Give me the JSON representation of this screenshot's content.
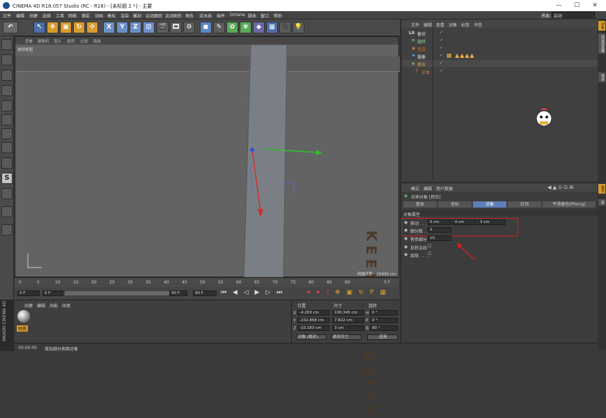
{
  "window": {
    "title": "CINEMA 4D R18.057 Studio (RC - R18) - [未标题 2 *] - 主要",
    "min": "—",
    "max": "☐",
    "close": "✕"
  },
  "menu": [
    "文件",
    "编辑",
    "创建",
    "选择",
    "工具",
    "网格",
    "捕捉",
    "动画",
    "模拟",
    "渲染",
    "雕刻",
    "运动跟踪",
    "运动图形",
    "角色",
    "流水线",
    "插件",
    "Octane",
    "脚本",
    "窗口",
    "帮助"
  ],
  "interface_label": "界面:",
  "interface_value": "启动",
  "viewport": {
    "menu": [
      "查看",
      "摄像机",
      "显示",
      "选项",
      "过滤",
      "面板"
    ],
    "view_name": "透视视图",
    "grid_label": "网格间距 : 10000 cm",
    "text": "KEEP CURIOSITY"
  },
  "object_manager": {
    "menu": [
      "文件",
      "编辑",
      "查看",
      "对象",
      "标签",
      "书签"
    ],
    "items": [
      {
        "name": "备份",
        "color": "#e0e0e0"
      },
      {
        "name": "旋转",
        "color": "#9fd89f"
      },
      {
        "name": "空白",
        "color": "#e07a3a"
      },
      {
        "name": "摄像",
        "color": "#e0e0e0"
      },
      {
        "name": "挤压",
        "color": "#e8b04a"
      },
      {
        "name": "文本",
        "color": "#e07a3a"
      }
    ]
  },
  "attributes": {
    "menu": [
      "模式",
      "编辑",
      "用户数据"
    ],
    "object_title": "拉伸对象 [挤压]",
    "tabs": [
      "基本",
      "坐标",
      "对象",
      "封顶",
      "平滑着色(Phong)"
    ],
    "active_tab": "对象",
    "section": "对象属性",
    "move_label": "移动 . . . .",
    "move_values": [
      "0 cm",
      "0 cm",
      "3 cm"
    ],
    "subdiv_label": "细分数 . .",
    "subdiv_value": "2",
    "iso_label": "等参细分",
    "iso_value": "10",
    "flip_label": "反转法线",
    "hier_label": "层级 . . . ."
  },
  "timeline": {
    "ticks": [
      "0",
      "5",
      "10",
      "15",
      "20",
      "25",
      "30",
      "35",
      "40",
      "45",
      "50",
      "55",
      "60",
      "65",
      "70",
      "75",
      "80",
      "85",
      "90"
    ],
    "frame_end": "0 F",
    "current": "0 F",
    "min_f": "0 F",
    "max_f": "90 F",
    "max_f2": "90 F"
  },
  "materials": {
    "menu": [
      "创建",
      "编辑",
      "功能",
      "纹理"
    ],
    "mat_name": "材质"
  },
  "coords": {
    "headers": [
      "位置",
      "尺寸",
      "旋转"
    ],
    "rows": [
      {
        "axis": "X",
        "pos": "-4.263 cm",
        "size": "100.345 cm",
        "rlabel": "H",
        "rot": "0 °"
      },
      {
        "axis": "Y",
        "pos": "-232.858 cm",
        "size": "7.822 cm",
        "rlabel": "P",
        "rot": "0 °"
      },
      {
        "axis": "Z",
        "pos": "-10.183 cm",
        "size": "3 cm",
        "rlabel": "B",
        "rot": "90 °"
      }
    ],
    "mode": "对象 (相对)",
    "size_mode": "绝对尺寸",
    "apply": "应用"
  },
  "status": {
    "time": "00:00:00",
    "msg": "增加细分表面对象"
  },
  "side_tabs": [
    "对象",
    "内容浏览器",
    "构造",
    "属性",
    "层"
  ]
}
